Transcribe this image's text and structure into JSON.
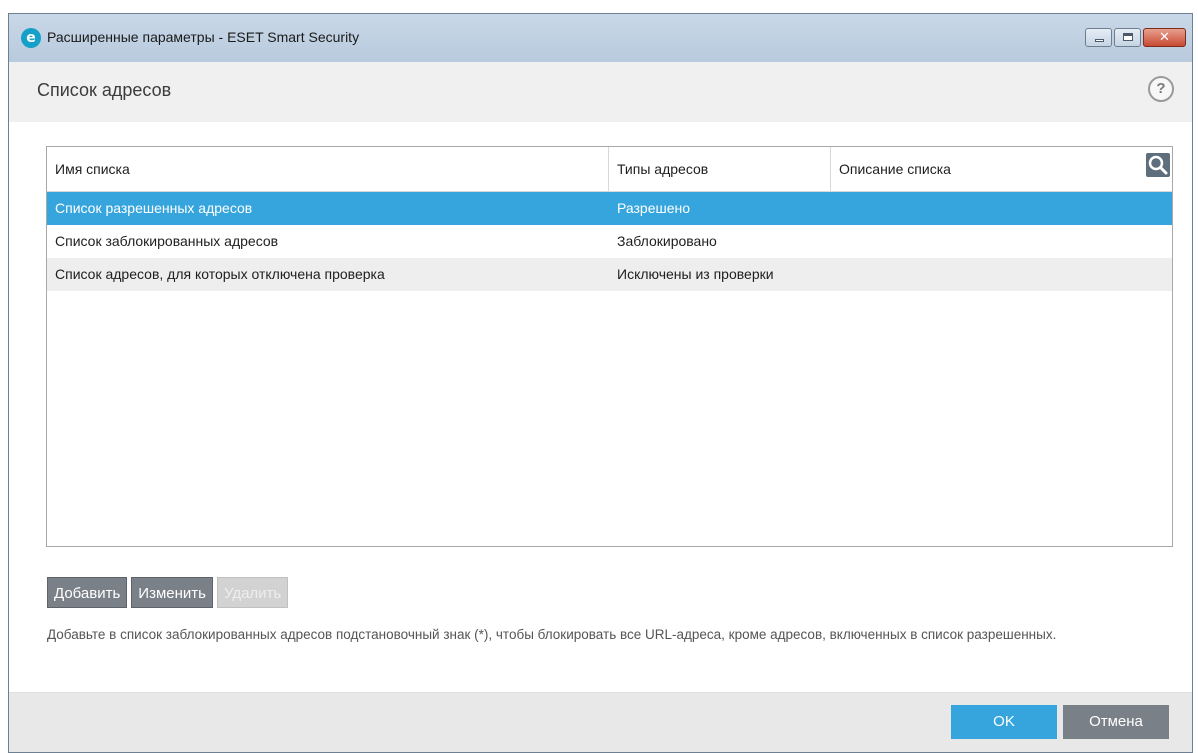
{
  "window": {
    "title": "Расширенные параметры - ESET Smart Security",
    "logo_letter": "e",
    "close_symbol": "✕"
  },
  "header": {
    "title": "Список адресов",
    "help_symbol": "?"
  },
  "table": {
    "columns": [
      "Имя списка",
      "Типы адресов",
      "Описание списка"
    ],
    "rows": [
      {
        "name": "Список разрешенных адресов",
        "type": "Разрешено",
        "description": "",
        "selected": true
      },
      {
        "name": "Список заблокированных адресов",
        "type": "Заблокировано",
        "description": "",
        "selected": false
      },
      {
        "name": "Список адресов, для которых отключена проверка",
        "type": "Исключены из проверки",
        "description": "",
        "selected": false
      }
    ]
  },
  "actions": {
    "add_label": "Добавить",
    "edit_label": "Изменить",
    "delete_label": "Удалить"
  },
  "hint": "Добавьте в список заблокированных адресов подстановочный знак (*), чтобы блокировать все URL-адреса, кроме адресов, включенных в список разрешенных.",
  "footer": {
    "ok_label": "OK",
    "cancel_label": "Отмена"
  },
  "colors": {
    "accent": "#36a5de",
    "button_gray": "#7a8087",
    "eset_logo": "#14a0c8"
  },
  "icons": {
    "app": "eset-logo-icon",
    "search": "search-icon",
    "help": "help-icon"
  }
}
